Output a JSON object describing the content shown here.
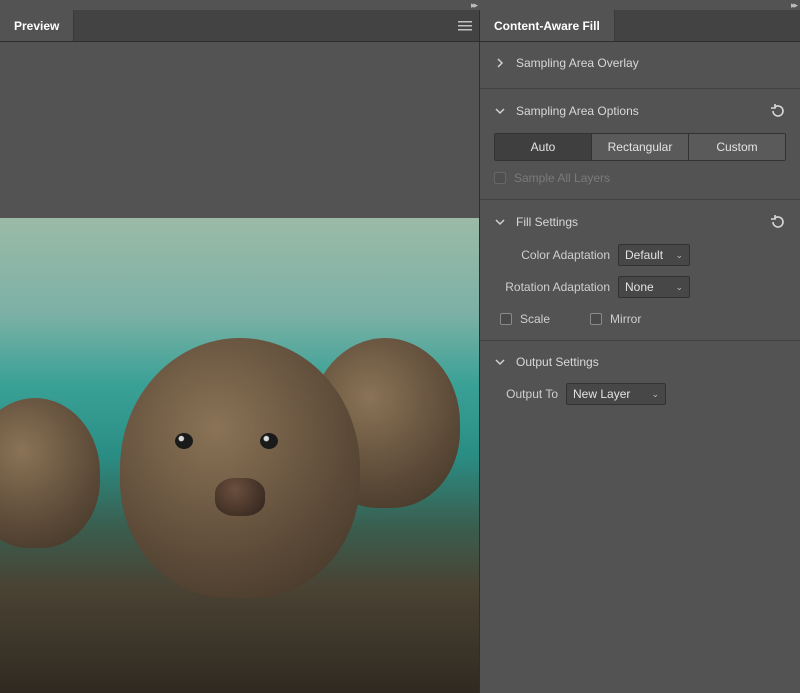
{
  "preview": {
    "tab_label": "Preview"
  },
  "panel": {
    "tab_label": "Content-Aware Fill",
    "sections": {
      "overlay": {
        "title": "Sampling Area Overlay",
        "expanded": false
      },
      "sampling": {
        "title": "Sampling Area Options",
        "expanded": true,
        "mode_options": [
          "Auto",
          "Rectangular",
          "Custom"
        ],
        "mode_selected": "Auto",
        "sample_all_layers_label": "Sample All Layers",
        "sample_all_layers_checked": false,
        "sample_all_layers_enabled": false
      },
      "fill": {
        "title": "Fill Settings",
        "expanded": true,
        "color_adaptation_label": "Color Adaptation",
        "color_adaptation_value": "Default",
        "rotation_adaptation_label": "Rotation Adaptation",
        "rotation_adaptation_value": "None",
        "scale_label": "Scale",
        "scale_checked": false,
        "mirror_label": "Mirror",
        "mirror_checked": false
      },
      "output": {
        "title": "Output Settings",
        "expanded": true,
        "output_to_label": "Output To",
        "output_to_value": "New Layer"
      }
    }
  }
}
